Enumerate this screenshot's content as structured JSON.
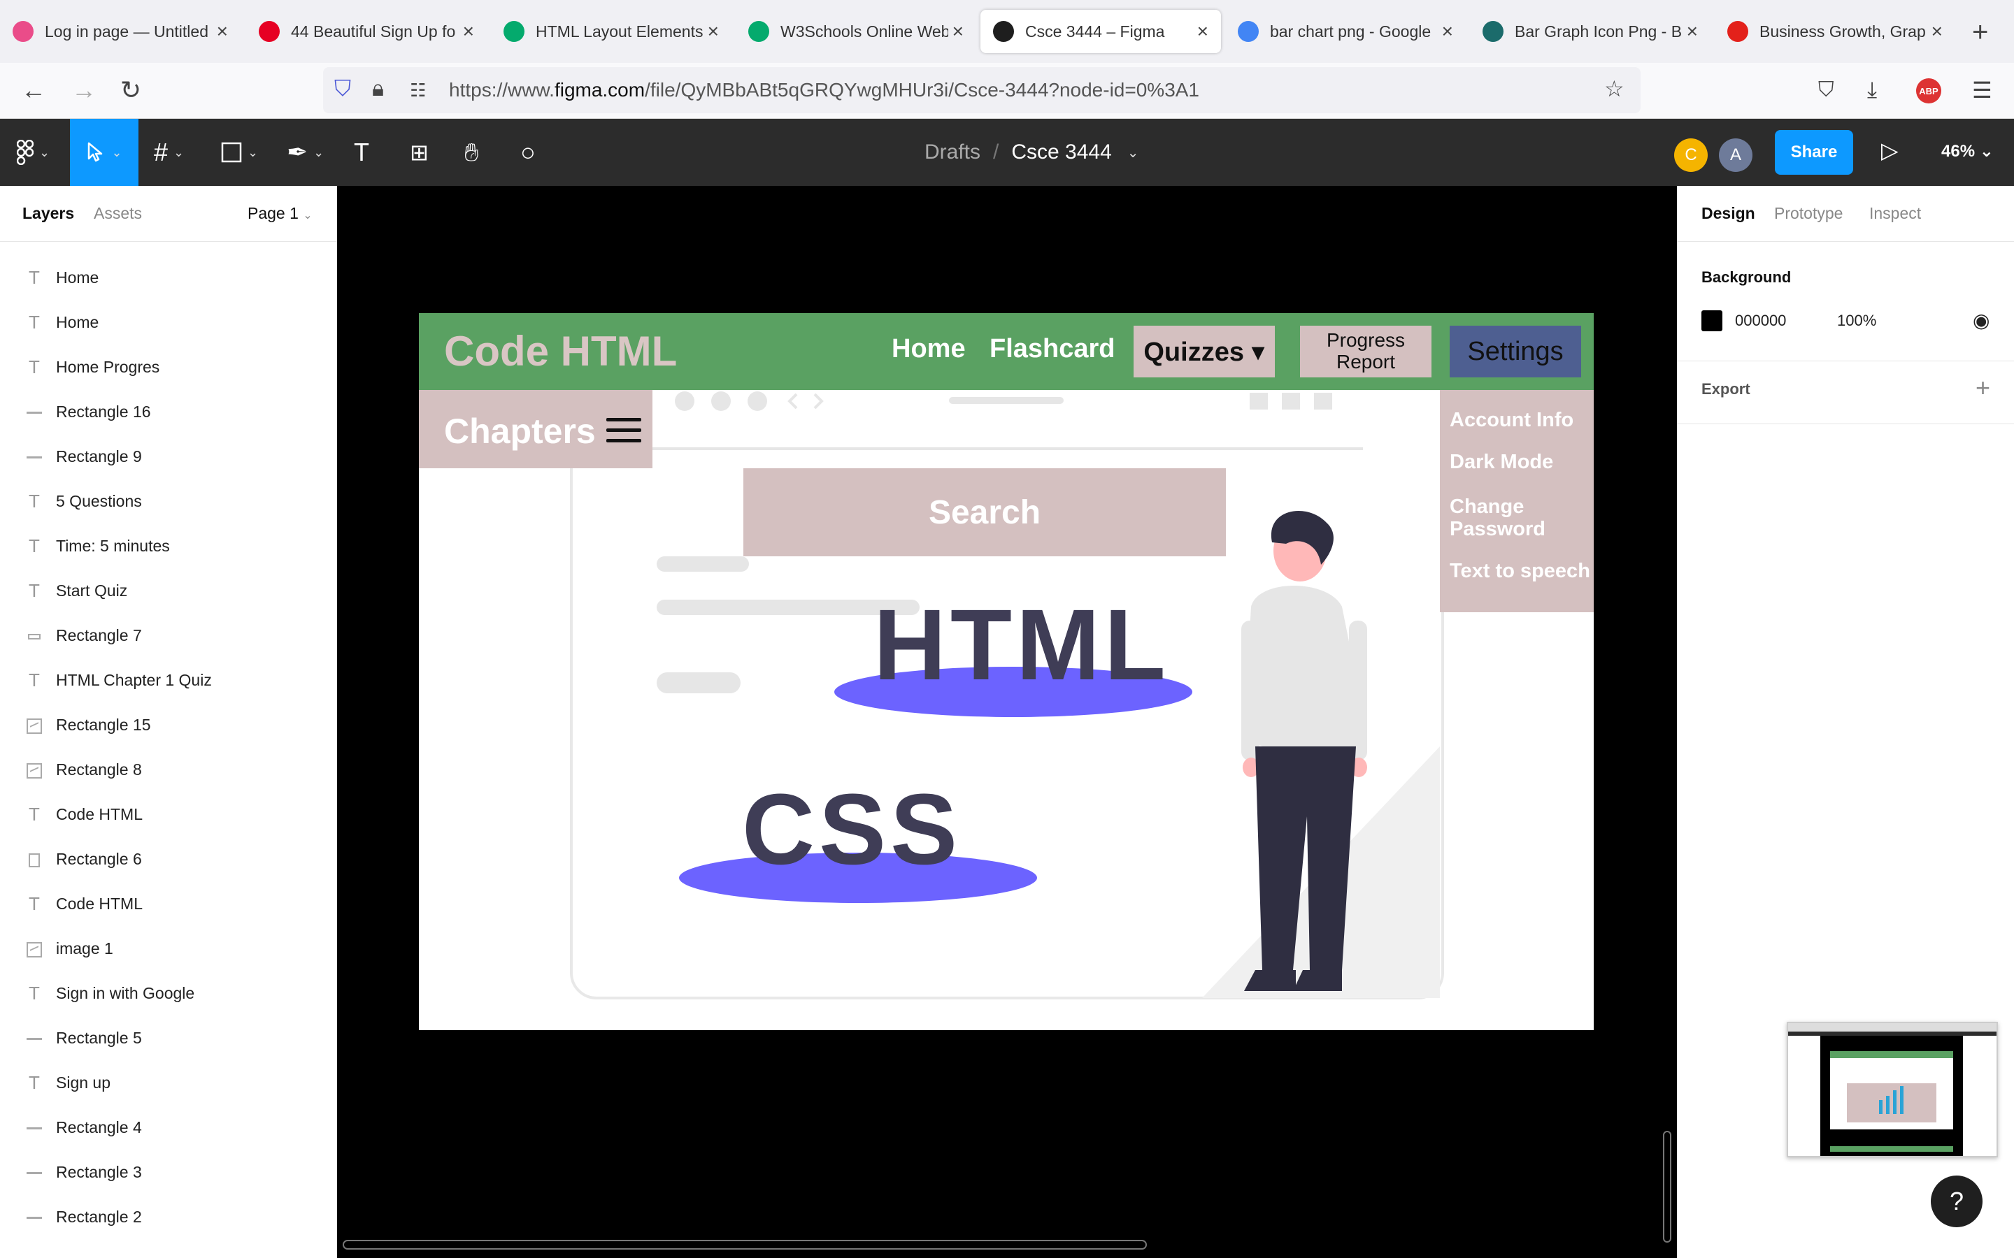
{
  "browser": {
    "tabs": [
      {
        "title": "Log in page — Untitled",
        "favicon": "dribbble-icon",
        "color": "#ea4c89"
      },
      {
        "title": "44 Beautiful Sign Up fo",
        "favicon": "pinterest-icon",
        "color": "#e60023"
      },
      {
        "title": "HTML Layout Elements",
        "favicon": "w3schools-icon",
        "color": "#04aa6d"
      },
      {
        "title": "W3Schools Online Web",
        "favicon": "w3schools-icon",
        "color": "#04aa6d"
      },
      {
        "title": "Csce 3444 – Figma",
        "favicon": "figma-icon",
        "color": "#1e1e1e",
        "active": true
      },
      {
        "title": "bar chart png - Google",
        "favicon": "google-icon",
        "color": "#4285f4"
      },
      {
        "title": "Bar Graph Icon Png - B",
        "favicon": "kp-icon",
        "color": "#1b6b6b"
      },
      {
        "title": "Business Growth, Grap",
        "favicon": "c-icon",
        "color": "#e3211b"
      }
    ],
    "url_prefix": "https://www.",
    "url_host": "figma.com",
    "url_path": "/file/QyMBbABt5qGRQYwgMHUr3i/Csce-3444?node-id=0%3A1"
  },
  "figma": {
    "breadcrumb_drafts": "Drafts",
    "breadcrumb_sep": "/",
    "file_name": "Csce 3444",
    "avatars": [
      {
        "letter": "C",
        "color": "#f5b400"
      },
      {
        "letter": "A",
        "color": "#6e7b9a"
      }
    ],
    "share_label": "Share",
    "zoom": "46%"
  },
  "left_panel": {
    "tab_layers": "Layers",
    "tab_assets": "Assets",
    "page": "Page 1",
    "layers": [
      {
        "type": "text",
        "name": "Home"
      },
      {
        "type": "text",
        "name": "Home"
      },
      {
        "type": "text",
        "name": "Home Progres"
      },
      {
        "type": "line",
        "name": "Rectangle 16"
      },
      {
        "type": "line",
        "name": "Rectangle 9"
      },
      {
        "type": "text",
        "name": "5 Questions"
      },
      {
        "type": "text",
        "name": "Time: 5 minutes"
      },
      {
        "type": "text",
        "name": "Start Quiz"
      },
      {
        "type": "rectw",
        "name": "Rectangle 7"
      },
      {
        "type": "text",
        "name": "HTML Chapter 1 Quiz"
      },
      {
        "type": "image",
        "name": "Rectangle 15"
      },
      {
        "type": "image",
        "name": "Rectangle 8"
      },
      {
        "type": "text",
        "name": "Code HTML"
      },
      {
        "type": "rect",
        "name": "Rectangle 6"
      },
      {
        "type": "text",
        "name": "Code HTML"
      },
      {
        "type": "image",
        "name": "image 1"
      },
      {
        "type": "text",
        "name": "Sign in with Google"
      },
      {
        "type": "line",
        "name": "Rectangle 5"
      },
      {
        "type": "text",
        "name": "Sign up"
      },
      {
        "type": "line",
        "name": "Rectangle 4"
      },
      {
        "type": "line",
        "name": "Rectangle 3"
      },
      {
        "type": "line",
        "name": "Rectangle 2"
      }
    ]
  },
  "frame": {
    "logo": "Code HTML",
    "nav_home": "Home",
    "nav_flashcard": "Flashcard",
    "nav_quizzes": "Quizzes ▾",
    "nav_progress": "Progress Report",
    "nav_settings": "Settings",
    "chapters": "Chapters",
    "search": "Search",
    "settings_menu": [
      "Account Info",
      "Dark Mode",
      "Change Password",
      "Text to speech"
    ],
    "illustration_html": "HTML",
    "illustration_css": "CSS",
    "colors": {
      "nav_green": "#5aa162",
      "pink": "#d4c0c0",
      "settings_blue": "#4e5f91",
      "blob_purple": "#6c63ff"
    }
  },
  "right_panel": {
    "tab_design": "Design",
    "tab_prototype": "Prototype",
    "tab_inspect": "Inspect",
    "background_label": "Background",
    "bg_hex": "000000",
    "bg_opacity": "100%",
    "export_label": "Export"
  },
  "help": "?"
}
